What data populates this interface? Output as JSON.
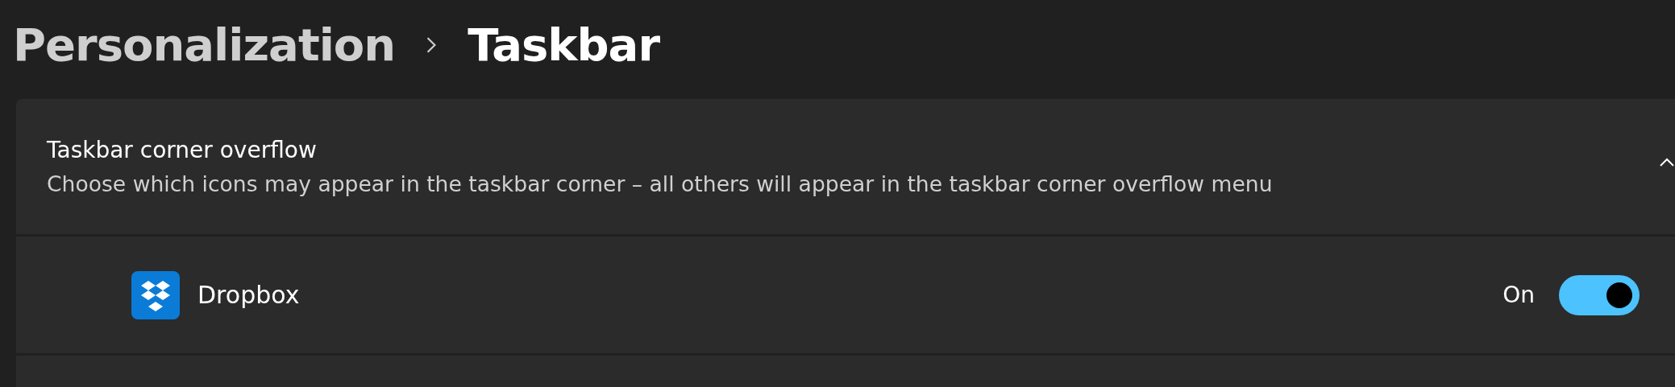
{
  "breadcrumb": [
    {
      "label": "Personalization",
      "current": false
    },
    {
      "label": "Taskbar",
      "current": true
    }
  ],
  "section": {
    "title": "Taskbar corner overflow",
    "description": "Choose which icons may appear in the taskbar corner – all others will appear in the taskbar corner overflow menu",
    "expanded": true,
    "items": [
      {
        "name": "Dropbox",
        "state_label": "On",
        "on": true
      }
    ]
  }
}
